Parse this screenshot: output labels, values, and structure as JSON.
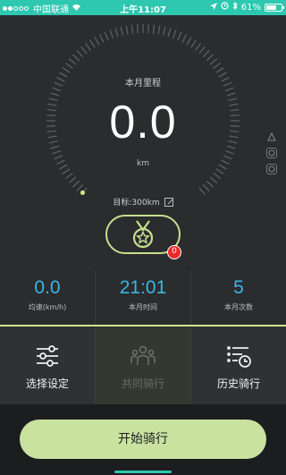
{
  "status_bar": {
    "carrier": "中国联通",
    "time": "上午11:07",
    "battery": "61%"
  },
  "dial": {
    "label": "本月里程",
    "value": "0.0",
    "unit": "km",
    "goal": "目标:300km"
  },
  "medal_badge": "0",
  "stats": [
    {
      "value": "0.0",
      "label": "均速(km/h)"
    },
    {
      "value": "21:01",
      "label": "本月时间"
    },
    {
      "value": "5",
      "label": "本月次数"
    }
  ],
  "menu": [
    {
      "label": "选择设定",
      "icon": "settings-sliders-icon"
    },
    {
      "label": "共同骑行",
      "icon": "group-ride-icon"
    },
    {
      "label": "历史骑行",
      "icon": "history-list-icon"
    }
  ],
  "start_button": "开始骑行",
  "colors": {
    "status_bar": "#2ec7b0",
    "accent_green": "#c9e2a0",
    "stat_blue": "#36b7e8",
    "badge_red": "#e62b2b"
  }
}
